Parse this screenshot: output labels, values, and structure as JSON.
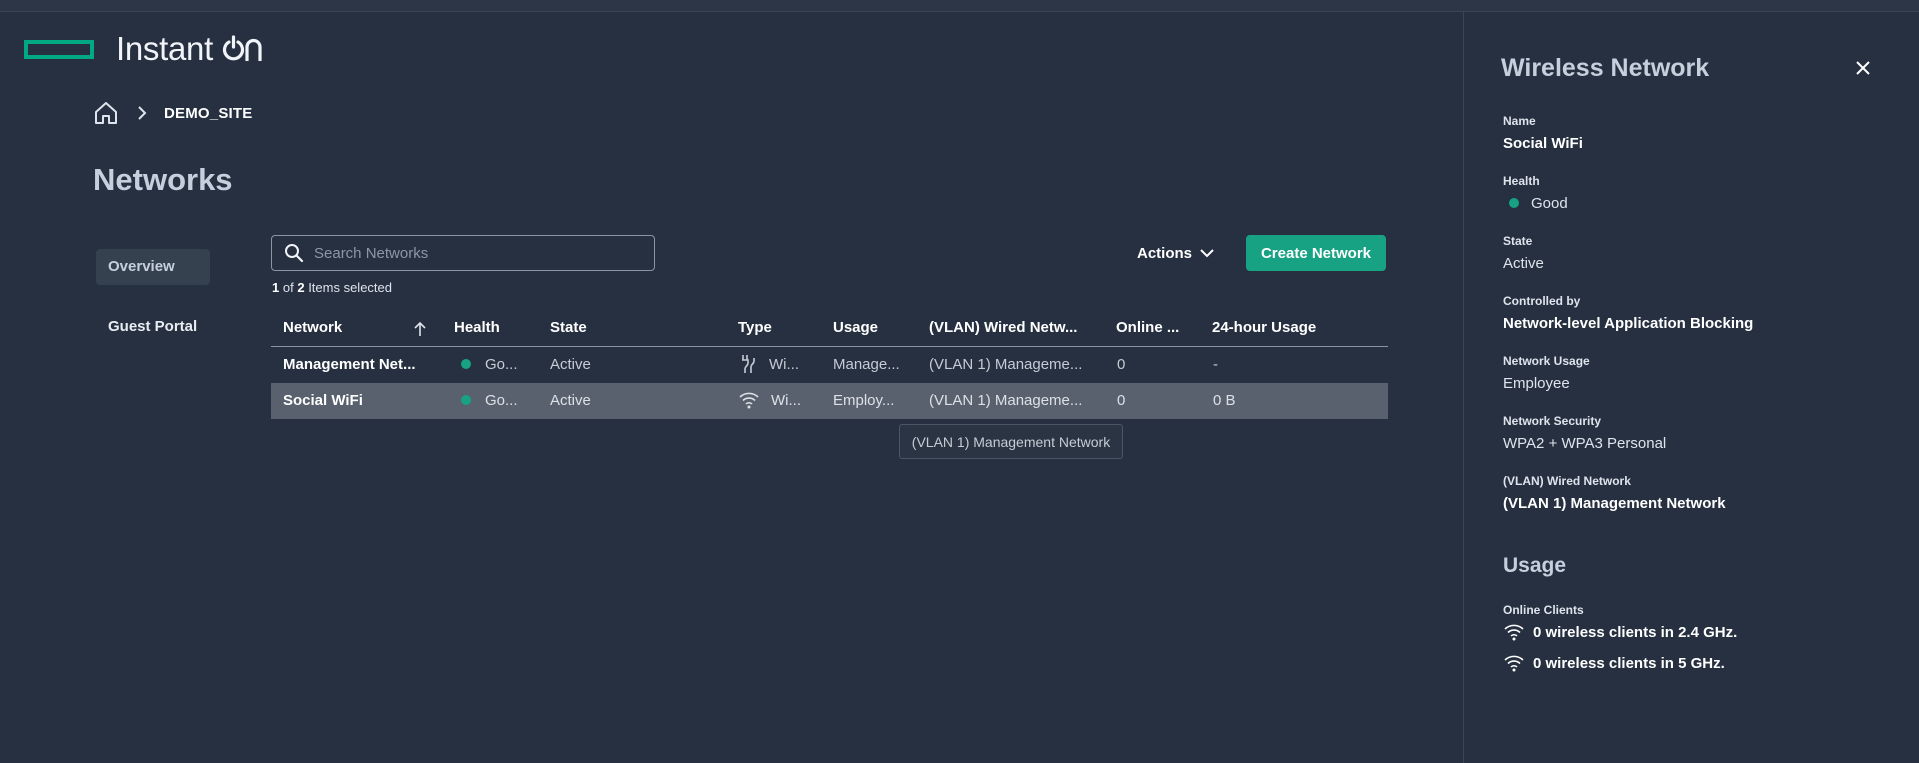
{
  "app": {
    "name": "Instant",
    "name_suffix": "on"
  },
  "breadcrumb": {
    "site": "DEMO_SITE"
  },
  "page": {
    "title": "Networks"
  },
  "side_tabs": [
    {
      "label": "Overview",
      "active": true
    },
    {
      "label": "Guest Portal",
      "active": false
    }
  ],
  "search": {
    "placeholder": "Search Networks",
    "value": ""
  },
  "selection": {
    "selected": "1",
    "of_label": "of",
    "total": "2",
    "suffix": "Items selected"
  },
  "toolbar": {
    "actions_label": "Actions",
    "create_label": "Create Network"
  },
  "table": {
    "columns": [
      "Network",
      "Health",
      "State",
      "Type",
      "Usage",
      "(VLAN) Wired Netw...",
      "Online ...",
      "24-hour Usage"
    ],
    "rows": [
      {
        "network": "Management Net...",
        "health": "Go...",
        "state": "Active",
        "type": "Wi...",
        "type_icon": "wired-icon",
        "usage": "Manage...",
        "vlan": "(VLAN 1) Manageme...",
        "online": "0",
        "usage24": "-",
        "selected": false
      },
      {
        "network": "Social WiFi",
        "health": "Go...",
        "state": "Active",
        "type": "Wi...",
        "type_icon": "wifi-icon",
        "usage": "Employ...",
        "vlan": "(VLAN 1) Manageme...",
        "online": "0",
        "usage24": "0 B",
        "selected": true
      }
    ]
  },
  "tooltip": {
    "text": "(VLAN 1) Management Network"
  },
  "panel": {
    "title": "Wireless Network",
    "fields": {
      "name_label": "Name",
      "name_value": "Social WiFi",
      "health_label": "Health",
      "health_value": "Good",
      "state_label": "State",
      "state_value": "Active",
      "controlled_label": "Controlled by",
      "controlled_value": "Network-level Application Blocking",
      "usage_label": "Network Usage",
      "usage_value": "Employee",
      "security_label": "Network Security",
      "security_value": "WPA2 + WPA3 Personal",
      "vlan_label": "(VLAN) Wired Network",
      "vlan_value": "(VLAN 1) Management Network"
    },
    "usage_section": {
      "title": "Usage",
      "online_label": "Online Clients",
      "clients_24": "0 wireless clients in 2.4 GHz.",
      "clients_5": "0 wireless clients in 5 GHz."
    }
  },
  "colors": {
    "accent": "#17a383",
    "background": "#263040",
    "selected_row": "#58616d"
  }
}
